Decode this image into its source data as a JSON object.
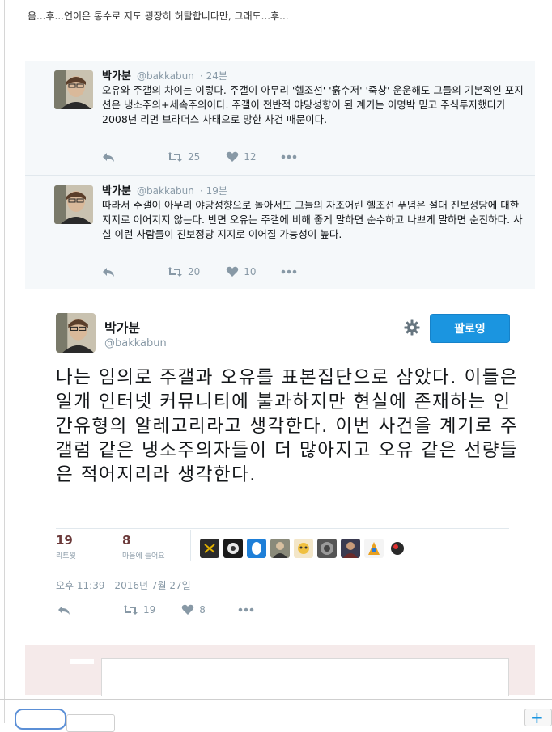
{
  "post": {
    "intro": "음...후...연이은 통수로 저도 굉장히 허탈합니다만, 그래도...후..."
  },
  "replies": [
    {
      "name": "박가분",
      "handle": "@bakkabun",
      "time": "· 24분",
      "text": "오유와 주갤의 차이는 이렇다. 주갤이 아무리 '헬조선' '흙수저' '죽창' 운운해도 그들의 기본적인 포지션은 냉소주의+세속주의이다. 주갤이 전반적 야당성향이 된 계기는 이명박 믿고 주식투자했다가 2008년 리먼 브라더스 사태으로 망한 사건 때문이다.",
      "retweets": "25",
      "likes": "12"
    },
    {
      "name": "박가분",
      "handle": "@bakkabun",
      "time": "· 19분",
      "text": "따라서 주갤이 아무리 야당성향으로 돌아서도 그들의 자조어린 헬조선 푸념은 절대 진보정당에 대한 지지로 이어지지 않는다. 반면 오유는 주갤에 비해 좋게 말하면 순수하고 나쁘게 말하면 순진하다. 사실 이런 사람들이 진보정당 지지로 이어질 가능성이 높다.",
      "retweets": "20",
      "likes": "10"
    }
  ],
  "main_tweet": {
    "name": "박가분",
    "handle": "@bakkabun",
    "follow_label": "팔로잉",
    "text": "나는 임의로 주갤과 오유를 표본집단으로 삼았다. 이들은 일개 인터넷 커뮤니티에 불과하지만 현실에 존재하는 인간유형의 알레고리라고 생각한다. 이번 사건을 계기로 주갤럼 같은 냉소주의자들이 더 많아지고 오유 같은 선량들은 적어지리라 생각한다.",
    "retweet_count": "19",
    "retweet_label": "리트윗",
    "like_count": "8",
    "like_label": "마음에 들어요",
    "timestamp": "오후 11:39 - 2016년 7월 27일",
    "action_retweets": "19",
    "action_likes": "8"
  },
  "colors": {
    "accent": "#1b95e0",
    "muted": "#8899a6",
    "panel": "#f5f8fa"
  },
  "icons": [
    "reply-icon",
    "retweet-icon",
    "heart-icon",
    "more-icon",
    "gear-icon",
    "plus-icon"
  ]
}
